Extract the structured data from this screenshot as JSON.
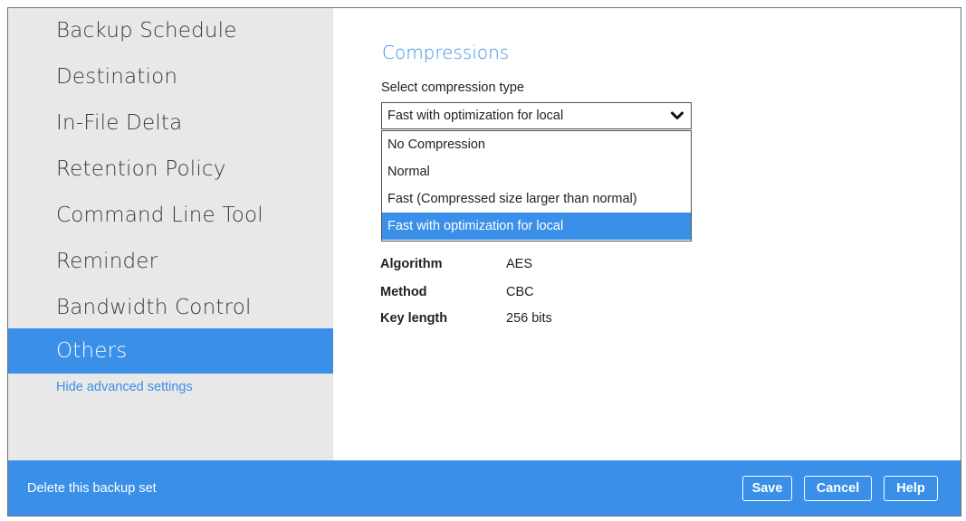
{
  "sidebar": {
    "items": [
      {
        "label": "Backup Schedule"
      },
      {
        "label": "Destination"
      },
      {
        "label": "In-File Delta"
      },
      {
        "label": "Retention Policy"
      },
      {
        "label": "Command Line Tool"
      },
      {
        "label": "Reminder"
      },
      {
        "label": "Bandwidth Control"
      },
      {
        "label": "Others",
        "active": true
      }
    ],
    "hide_advanced_label": "Hide advanced settings"
  },
  "main": {
    "section_title": "Compressions",
    "compression_label": "Select compression type",
    "compression_selected": "Fast with optimization for local",
    "compression_options": [
      "No Compression",
      "Normal",
      "Fast (Compressed size larger than normal)",
      "Fast with optimization for local"
    ],
    "encryption": {
      "algorithm_label": "Algorithm",
      "algorithm_value": "AES",
      "method_label": "Method",
      "method_value": "CBC",
      "key_length_label": "Key length",
      "key_length_value": "256 bits"
    }
  },
  "footer": {
    "delete_label": "Delete this backup set",
    "save_label": "Save",
    "cancel_label": "Cancel",
    "help_label": "Help"
  },
  "colors": {
    "accent": "#3a8fe9",
    "link": "#3b8fe6",
    "sidebar_bg": "#e8e8e8"
  },
  "icons": {
    "dropdown": "chevron-down-icon"
  }
}
